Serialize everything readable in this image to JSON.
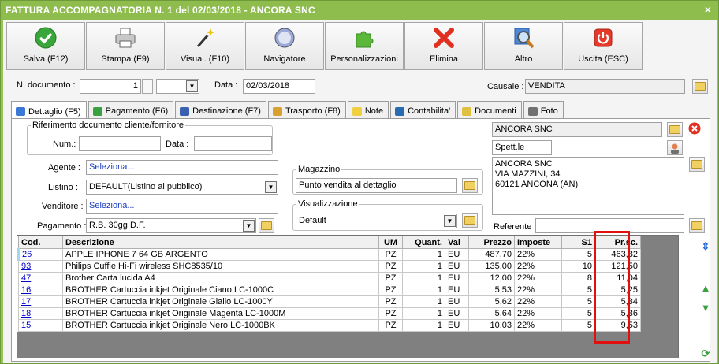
{
  "window": {
    "title": "FATTURA ACCOMPAGNATORIA N. 1 del 02/03/2018 - ANCORA SNC",
    "close": "×"
  },
  "toolbar": [
    {
      "label": "Salva (F12)",
      "icon": "check-icon"
    },
    {
      "label": "Stampa (F9)",
      "icon": "printer-icon"
    },
    {
      "label": "Visual. (F10)",
      "icon": "magic-wand-icon"
    },
    {
      "label": "Navigatore",
      "icon": "compass-icon"
    },
    {
      "label": "Personalizzazioni",
      "icon": "puzzle-icon"
    },
    {
      "label": "Elimina",
      "icon": "delete-x-icon"
    },
    {
      "label": "Altro",
      "icon": "magnifier-icon"
    },
    {
      "label": "Uscita (ESC)",
      "icon": "power-icon"
    }
  ],
  "header": {
    "ndoc_label": "N. documento :",
    "ndoc_value": "1",
    "suffix_value": "",
    "data_label": "Data :",
    "data_value": "02/03/2018",
    "causale_label": "Causale :",
    "causale_value": "VENDITA"
  },
  "tabs": [
    {
      "label": "Dettaglio (F5)",
      "color": "#3a78d8"
    },
    {
      "label": "Pagamento (F6)",
      "color": "#3aa040"
    },
    {
      "label": "Destinazione (F7)",
      "color": "#3a60b0"
    },
    {
      "label": "Trasporto (F8)",
      "color": "#d8a030"
    },
    {
      "label": "Note",
      "color": "#f0d040"
    },
    {
      "label": "Contabilita'",
      "color": "#2a6ab0"
    },
    {
      "label": "Documenti",
      "color": "#e0c040"
    },
    {
      "label": "Foto",
      "color": "#707070"
    }
  ],
  "rif": {
    "legend": "Riferimento documento cliente/fornitore",
    "num_label": "Num.:",
    "num_value": "",
    "data_label": "Data :",
    "data_value": ""
  },
  "agente": {
    "label": "Agente :",
    "value": "Seleziona..."
  },
  "listino": {
    "label": "Listino :",
    "value": "DEFAULT(Listino al pubblico)"
  },
  "venditore": {
    "label": "Venditore :",
    "value": "Seleziona..."
  },
  "pagamento": {
    "label": "Pagamento :",
    "value": "R.B. 30gg D.F."
  },
  "magazzino": {
    "legend": "Magazzino",
    "value": "Punto vendita al dettaglio"
  },
  "visualizzazione": {
    "legend": "Visualizzazione",
    "value": "Default"
  },
  "cliente": {
    "name": "ANCORA SNC",
    "spett": "Spett.le",
    "address": [
      "ANCORA SNC",
      "VIA MAZZINI, 34",
      "60121 ANCONA (AN)"
    ],
    "referente_label": "Referente",
    "referente_value": ""
  },
  "grid": {
    "columns": [
      "Cod.",
      "Descrizione",
      "UM",
      "Quant.",
      "Val",
      "Prezzo",
      "Imposte",
      "S1",
      "Pr.sc."
    ],
    "rows": [
      [
        "26",
        "APPLE IPHONE 7 64 GB ARGENTO",
        "PZ",
        "1",
        "EU",
        "487,70",
        "22%",
        "5",
        "463,32"
      ],
      [
        "93",
        "Philips Cuffie Hi-Fi wireless SHC8535/10",
        "PZ",
        "1",
        "EU",
        "135,00",
        "22%",
        "10",
        "121,50"
      ],
      [
        "47",
        "Brother Carta lucida A4",
        "PZ",
        "1",
        "EU",
        "12,00",
        "22%",
        "8",
        "11,04"
      ],
      [
        "16",
        "BROTHER Cartuccia inkjet Originale Ciano LC-1000C",
        "PZ",
        "1",
        "EU",
        "5,53",
        "22%",
        "5",
        "5,25"
      ],
      [
        "17",
        "BROTHER Cartuccia inkjet Originale Giallo LC-1000Y",
        "PZ",
        "1",
        "EU",
        "5,62",
        "22%",
        "5",
        "5,34"
      ],
      [
        "18",
        "BROTHER Cartuccia inkjet Originale Magenta LC-1000M",
        "PZ",
        "1",
        "EU",
        "5,64",
        "22%",
        "5",
        "5,36"
      ],
      [
        "15",
        "BROTHER Cartuccia inkjet Originale Nero LC-1000BK",
        "PZ",
        "1",
        "EU",
        "10,03",
        "22%",
        "5",
        "9,53"
      ]
    ]
  }
}
